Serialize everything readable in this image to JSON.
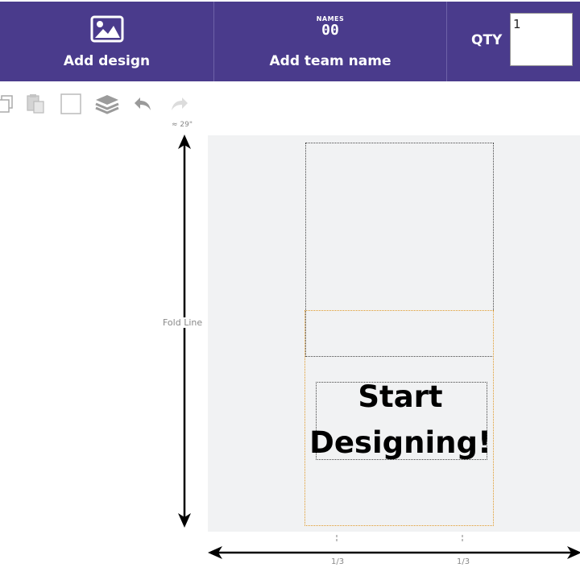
{
  "toolbar": {
    "add_design_label": "Add design",
    "add_team_name_label": "Add team name",
    "team_icon_top": "NAMES",
    "team_icon_number": "00",
    "qty_label": "QTY",
    "qty_value": "1"
  },
  "tools": [
    "copy-icon",
    "paste-icon",
    "select-box-icon",
    "layers-icon",
    "undo-icon",
    "redo-icon"
  ],
  "ruler": {
    "height_label": "≈ 29\"",
    "fold_label": "Fold Line",
    "tick_left": "1/3",
    "tick_right": "1/3"
  },
  "canvas": {
    "placeholder_line1": "Start",
    "placeholder_line2": "Designing!"
  },
  "colors": {
    "brand_purple": "#4a3b8c",
    "canvas_bg": "#f1f2f3",
    "zone_orange": "#e09a2a"
  }
}
